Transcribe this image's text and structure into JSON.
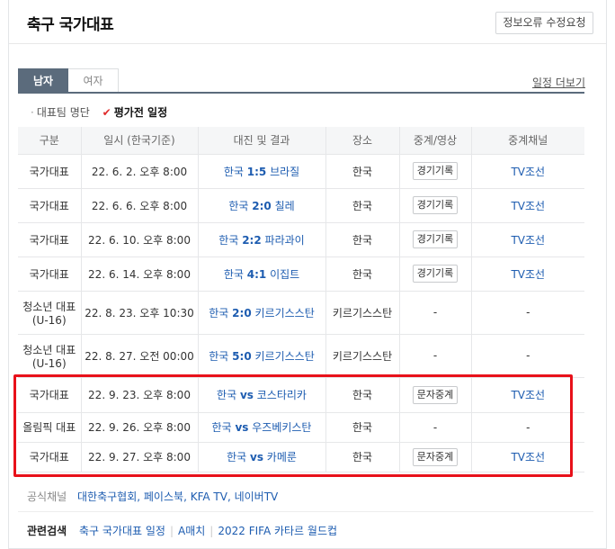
{
  "header": {
    "title": "축구 국가대표",
    "report_button": "정보오류 수정요청"
  },
  "tabs": [
    {
      "label": "남자",
      "selected": true
    },
    {
      "label": "여자",
      "selected": false
    }
  ],
  "more_link": "일정 더보기",
  "sub_nav": {
    "roster": "대표팀 명단",
    "schedule": "평가전 일정",
    "check_icon": "✔"
  },
  "table": {
    "headers": [
      "구분",
      "일시 (한국기준)",
      "대진 및 결과",
      "장소",
      "중계/영상",
      "중계채널"
    ],
    "rows": [
      {
        "category": "국가대표",
        "category2": "",
        "date": "22. 6. 2. 오후 8:00",
        "team_a": "한국",
        "score": "1:5",
        "team_b": "브라질",
        "venue": "한국",
        "media": "경기기록",
        "media_is_button": true,
        "channel": "TV조선"
      },
      {
        "category": "국가대표",
        "category2": "",
        "date": "22. 6. 6. 오후 8:00",
        "team_a": "한국",
        "score": "2:0",
        "team_b": "칠레",
        "venue": "한국",
        "media": "경기기록",
        "media_is_button": true,
        "channel": "TV조선"
      },
      {
        "category": "국가대표",
        "category2": "",
        "date": "22. 6. 10. 오후 8:00",
        "team_a": "한국",
        "score": "2:2",
        "team_b": "파라과이",
        "venue": "한국",
        "media": "경기기록",
        "media_is_button": true,
        "channel": "TV조선"
      },
      {
        "category": "국가대표",
        "category2": "",
        "date": "22. 6. 14. 오후 8:00",
        "team_a": "한국",
        "score": "4:1",
        "team_b": "이집트",
        "venue": "한국",
        "media": "경기기록",
        "media_is_button": true,
        "channel": "TV조선"
      },
      {
        "category": "청소년 대표",
        "category2": "(U-16)",
        "date": "22. 8. 23. 오후 10:30",
        "team_a": "한국",
        "score": "2:0",
        "team_b": "키르기스스탄",
        "venue": "키르기스스탄",
        "media": "-",
        "media_is_button": false,
        "channel": "-"
      },
      {
        "category": "청소년 대표",
        "category2": "(U-16)",
        "date": "22. 8. 27. 오전 00:00",
        "team_a": "한국",
        "score": "5:0",
        "team_b": "키르기스스탄",
        "venue": "키르기스스탄",
        "media": "-",
        "media_is_button": false,
        "channel": "-"
      },
      {
        "category": "국가대표",
        "category2": "",
        "date": "22. 9. 23. 오후 8:00",
        "team_a": "한국",
        "score": "vs",
        "team_b": "코스타리카",
        "venue": "한국",
        "media": "문자중계",
        "media_is_button": true,
        "channel": "TV조선"
      },
      {
        "category": "올림픽 대표",
        "category2": "",
        "date": "22. 9. 26. 오후 8:00",
        "team_a": "한국",
        "score": "vs",
        "team_b": "우즈베키스탄",
        "venue": "한국",
        "media": "-",
        "media_is_button": false,
        "channel": "-"
      },
      {
        "category": "국가대표",
        "category2": "",
        "date": "22. 9. 27. 오후 8:00",
        "team_a": "한국",
        "score": "vs",
        "team_b": "카메룬",
        "venue": "한국",
        "media": "문자중계",
        "media_is_button": true,
        "channel": "TV조선"
      }
    ]
  },
  "official": {
    "label": "공식채널",
    "links": [
      "대한축구협회",
      "페이스북",
      "KFA TV",
      "네이버TV"
    ]
  },
  "related": {
    "label": "관련검색",
    "keywords": [
      "축구 국가대표 일정",
      "A매치",
      "2022 FIFA 카타르 월드컵"
    ]
  },
  "colors": {
    "tab_active": "#5b6b7c",
    "link_blue": "#1d5cb0",
    "highlight_red": "#e8111a"
  }
}
